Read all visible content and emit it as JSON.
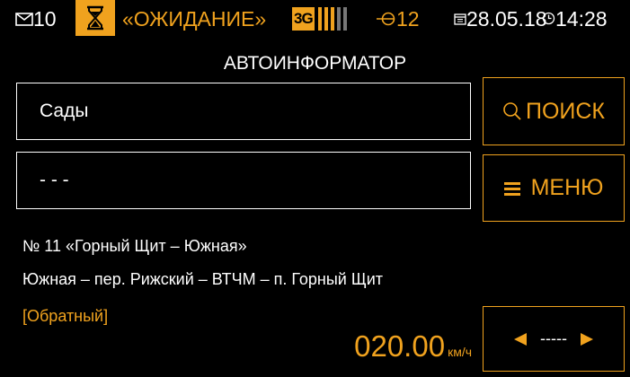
{
  "status": {
    "mail_count": "10",
    "state_label": "«ОЖИДАНИЕ»",
    "network": "3G",
    "signal_bars": 3,
    "signal_max": 5,
    "satellites": "12",
    "date": "28.05.18",
    "time": "14:28"
  },
  "title": "АВТОИНФОРМАТОР",
  "stop_field": "Сады",
  "next_field": "- - -",
  "search_button": "ПОИСК",
  "menu_button": "МЕНЮ",
  "route_info": {
    "route": "№ 11 «Горный Щит – Южная»",
    "stops": "Южная – пер. Рижский – ВТЧМ – п. Горный Щит",
    "direction": "[Обратный]"
  },
  "speed": {
    "value": "020.00",
    "unit": "км/ч"
  },
  "direction_control": {
    "value": "-----"
  },
  "colors": {
    "accent": "#f0a21e",
    "background": "#000000",
    "text": "#ffffff"
  },
  "icons": [
    "mail-icon",
    "hourglass-icon",
    "signal-icon",
    "satellite-icon",
    "calendar-icon",
    "clock-icon",
    "search-icon",
    "menu-icon",
    "arrow-left-icon",
    "arrow-right-icon"
  ]
}
